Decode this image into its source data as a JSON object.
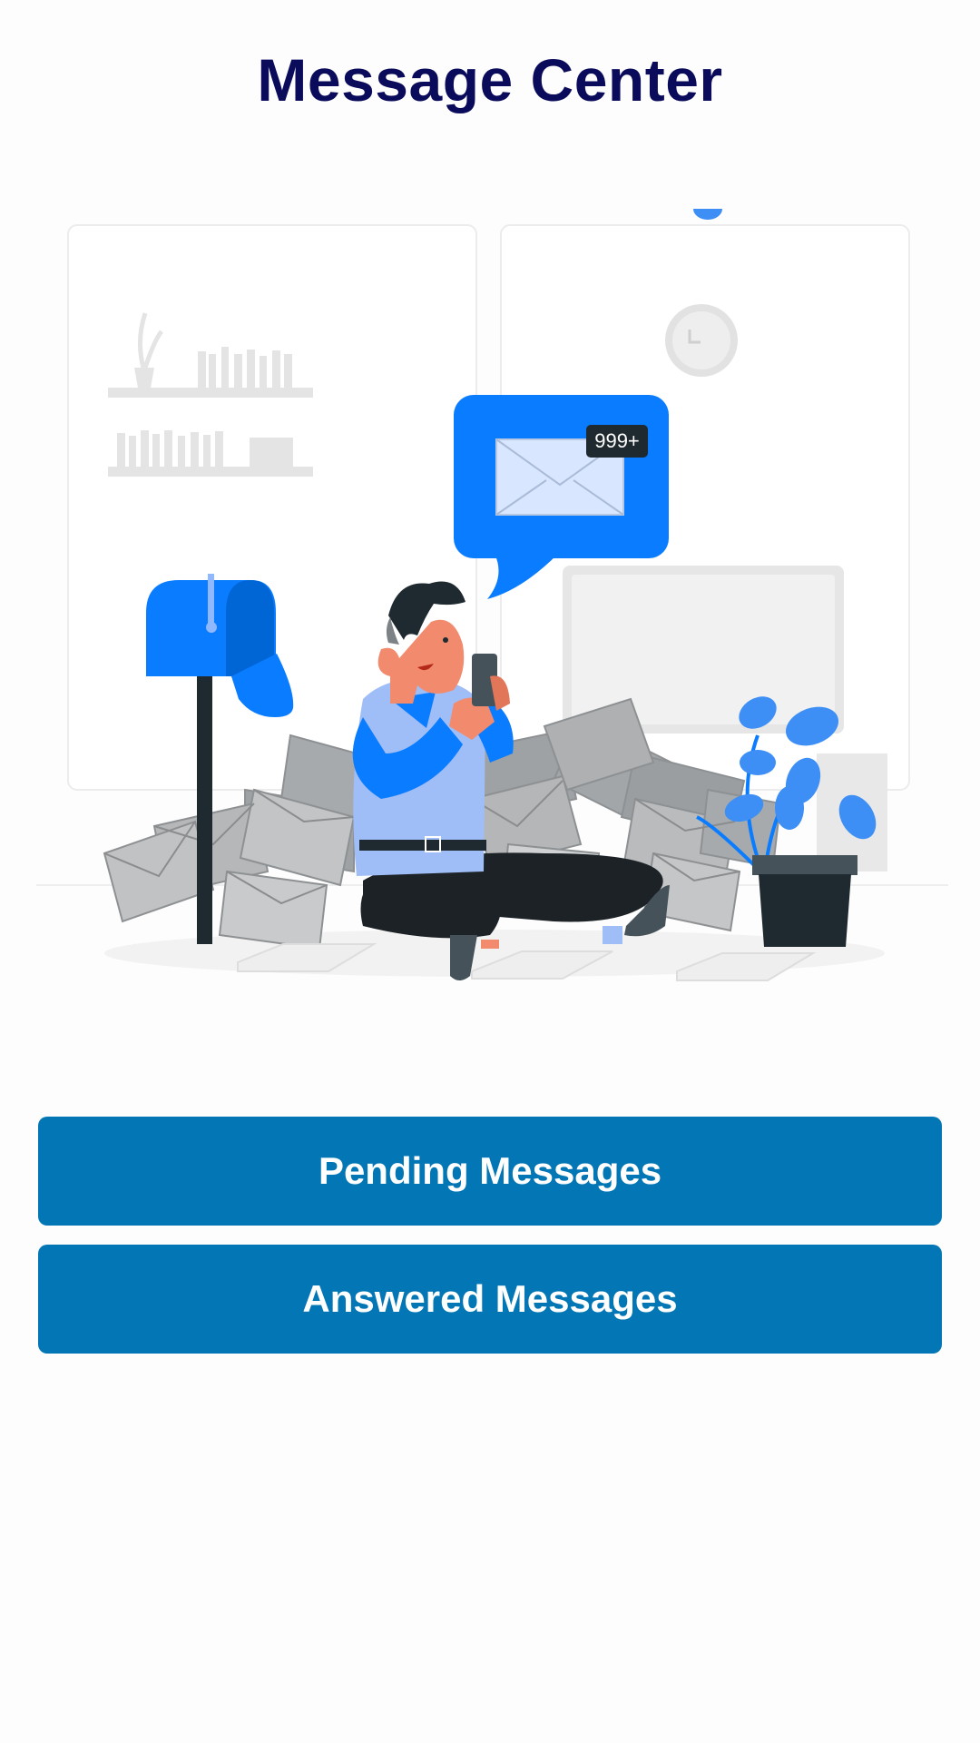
{
  "header": {
    "title": "Message Center"
  },
  "illustration": {
    "badge_text": "999+",
    "colors": {
      "accent_blue": "#0a7cff",
      "dark": "#1f2a30",
      "envelope_gray": "#a9abad",
      "wall_gray": "#ececec"
    }
  },
  "actions": {
    "pending_label": "Pending Messages",
    "answered_label": "Answered Messages"
  }
}
